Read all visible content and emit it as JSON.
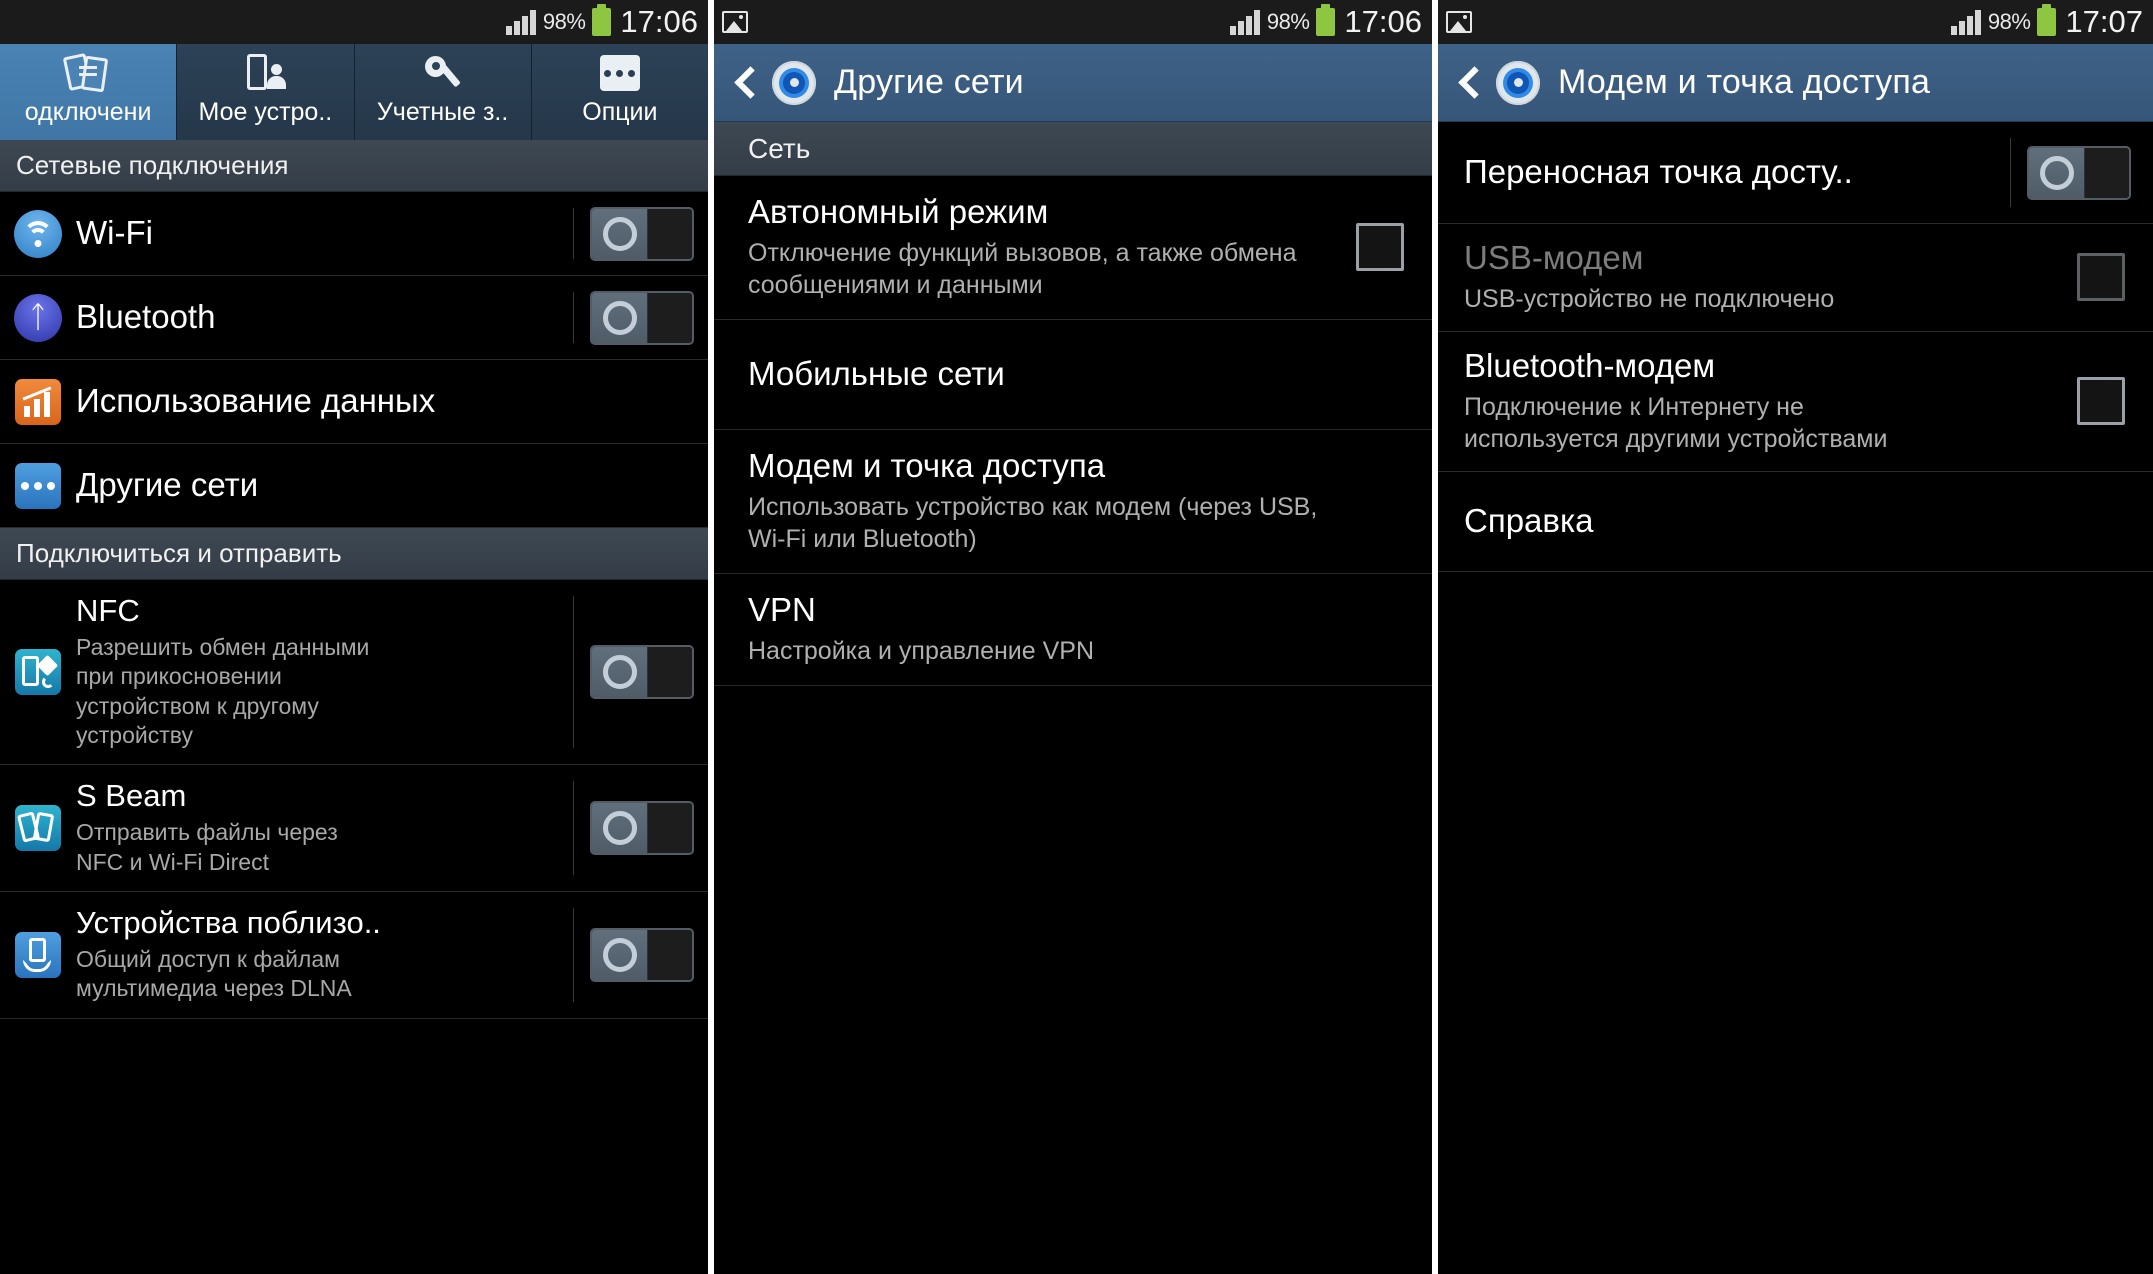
{
  "status_bar": {
    "battery_percent": "98%",
    "time_left": "17:06",
    "time_mid": "17:06",
    "time_right": "17:07"
  },
  "panel1": {
    "tabs": [
      {
        "label": "одключени",
        "icon": "connections-icon",
        "active": true
      },
      {
        "label": "Мое устро..",
        "icon": "device-icon",
        "active": false
      },
      {
        "label": "Учетные з..",
        "icon": "key-icon",
        "active": false
      },
      {
        "label": "Опции",
        "icon": "more-options-icon",
        "active": false
      }
    ],
    "section1": "Сетевые подключения",
    "items1": [
      {
        "title": "Wi-Fi",
        "icon": "wifi-icon",
        "control": "toggle-off"
      },
      {
        "title": "Bluetooth",
        "icon": "bluetooth-icon",
        "control": "toggle-off"
      },
      {
        "title": "Использование данных",
        "icon": "data-usage-icon",
        "control": "none"
      },
      {
        "title": "Другие сети",
        "icon": "other-networks-icon",
        "control": "none"
      }
    ],
    "section2": "Подключиться и отправить",
    "items2": [
      {
        "title": "NFC",
        "sub": "Разрешить обмен данными при прикосновении устройством к другому устройству",
        "icon": "nfc-icon",
        "control": "toggle-off"
      },
      {
        "title": "S Beam",
        "sub": "Отправить файлы через NFC и Wi-Fi Direct",
        "icon": "s-beam-icon",
        "control": "toggle-off"
      },
      {
        "title": "Устройства поблизо..",
        "sub": "Общий доступ к файлам мультимедиа через DLNA",
        "icon": "nearby-devices-icon",
        "control": "toggle-off"
      }
    ]
  },
  "panel2": {
    "title": "Другие сети",
    "section": "Сеть",
    "items": [
      {
        "title": "Автономный режим",
        "sub": "Отключение функций вызовов, а также обмена сообщениями и данными",
        "control": "checkbox-unchecked"
      },
      {
        "title": "Мобильные сети",
        "sub": "",
        "control": "none"
      },
      {
        "title": "Модем и точка доступа",
        "sub": "Использовать устройство как модем (через USB, Wi-Fi или Bluetooth)",
        "control": "none"
      },
      {
        "title": "VPN",
        "sub": "Настройка и управление VPN",
        "control": "none"
      }
    ]
  },
  "panel3": {
    "title": "Модем и точка доступа",
    "items": [
      {
        "title": "Переносная точка досту..",
        "sub": "",
        "control": "toggle-off",
        "disabled": false
      },
      {
        "title": "USB-модем",
        "sub": "USB-устройство не подключено",
        "control": "checkbox-unchecked",
        "disabled": true
      },
      {
        "title": "Bluetooth-модем",
        "sub": "Подключение к Интернету не используется другими устройствами",
        "control": "checkbox-unchecked",
        "disabled": false
      },
      {
        "title": "Справка",
        "sub": "",
        "control": "none",
        "disabled": false
      }
    ]
  },
  "colors": {
    "accent_blue": "#3f6288",
    "active_tab": "#4a83b4",
    "battery_green": "#8ec641",
    "section_header": "#3e4853"
  }
}
